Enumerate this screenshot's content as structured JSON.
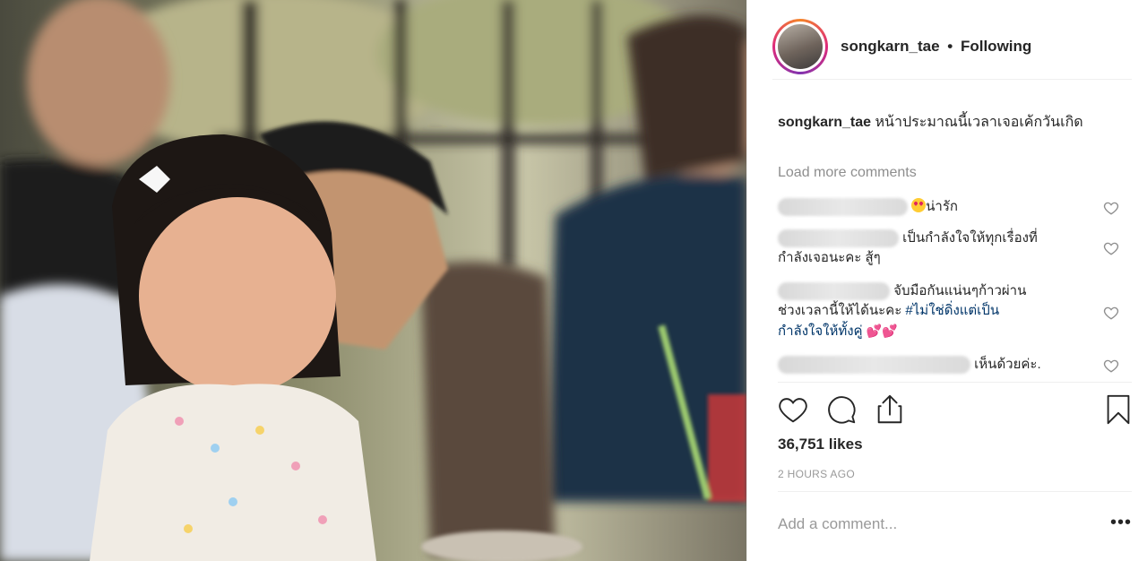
{
  "photo": {
    "description_icon": "post-photo"
  },
  "post_header": {
    "username": "songkarn_tae",
    "separator": "•",
    "follow_status": "Following"
  },
  "caption": {
    "username": "songkarn_tae",
    "text": "หน้าประมาณนี้เวลาเจอเค้กวันเกิด"
  },
  "load_more": "Load more comments",
  "comments": [
    {
      "text_pre": "",
      "text": "น่ารัก",
      "emoji": "heart-eyes-emoji"
    },
    {
      "text_line1": "เป็นกำลังใจให้ทุกเรื่องที่",
      "text_line2": "กำลังเจอนะคะ สู้ๆ"
    },
    {
      "text_line1": "จับมือกันแน่นๆก้าวผ่าน",
      "text_line2_pre": "ช่วงเวลานี้ให้ได้นะคะ ",
      "hashtag": "#ไม่ใช่ดิ่งแต่เป็น",
      "hashtag2": "กำลังใจให้ทั้งคู่",
      "emoji": "💕💕"
    },
    {
      "text": "เห็นด้วยค่ะ."
    }
  ],
  "likes": "36,751 likes",
  "time": "2 HOURS AGO",
  "add_comment": {
    "placeholder": "Add a comment...",
    "more": "•••"
  },
  "colors": {
    "hashtag": "#003569",
    "muted": "#8e8e8e",
    "ring_start": "#f58529",
    "ring_mid": "#dd2a7b"
  }
}
